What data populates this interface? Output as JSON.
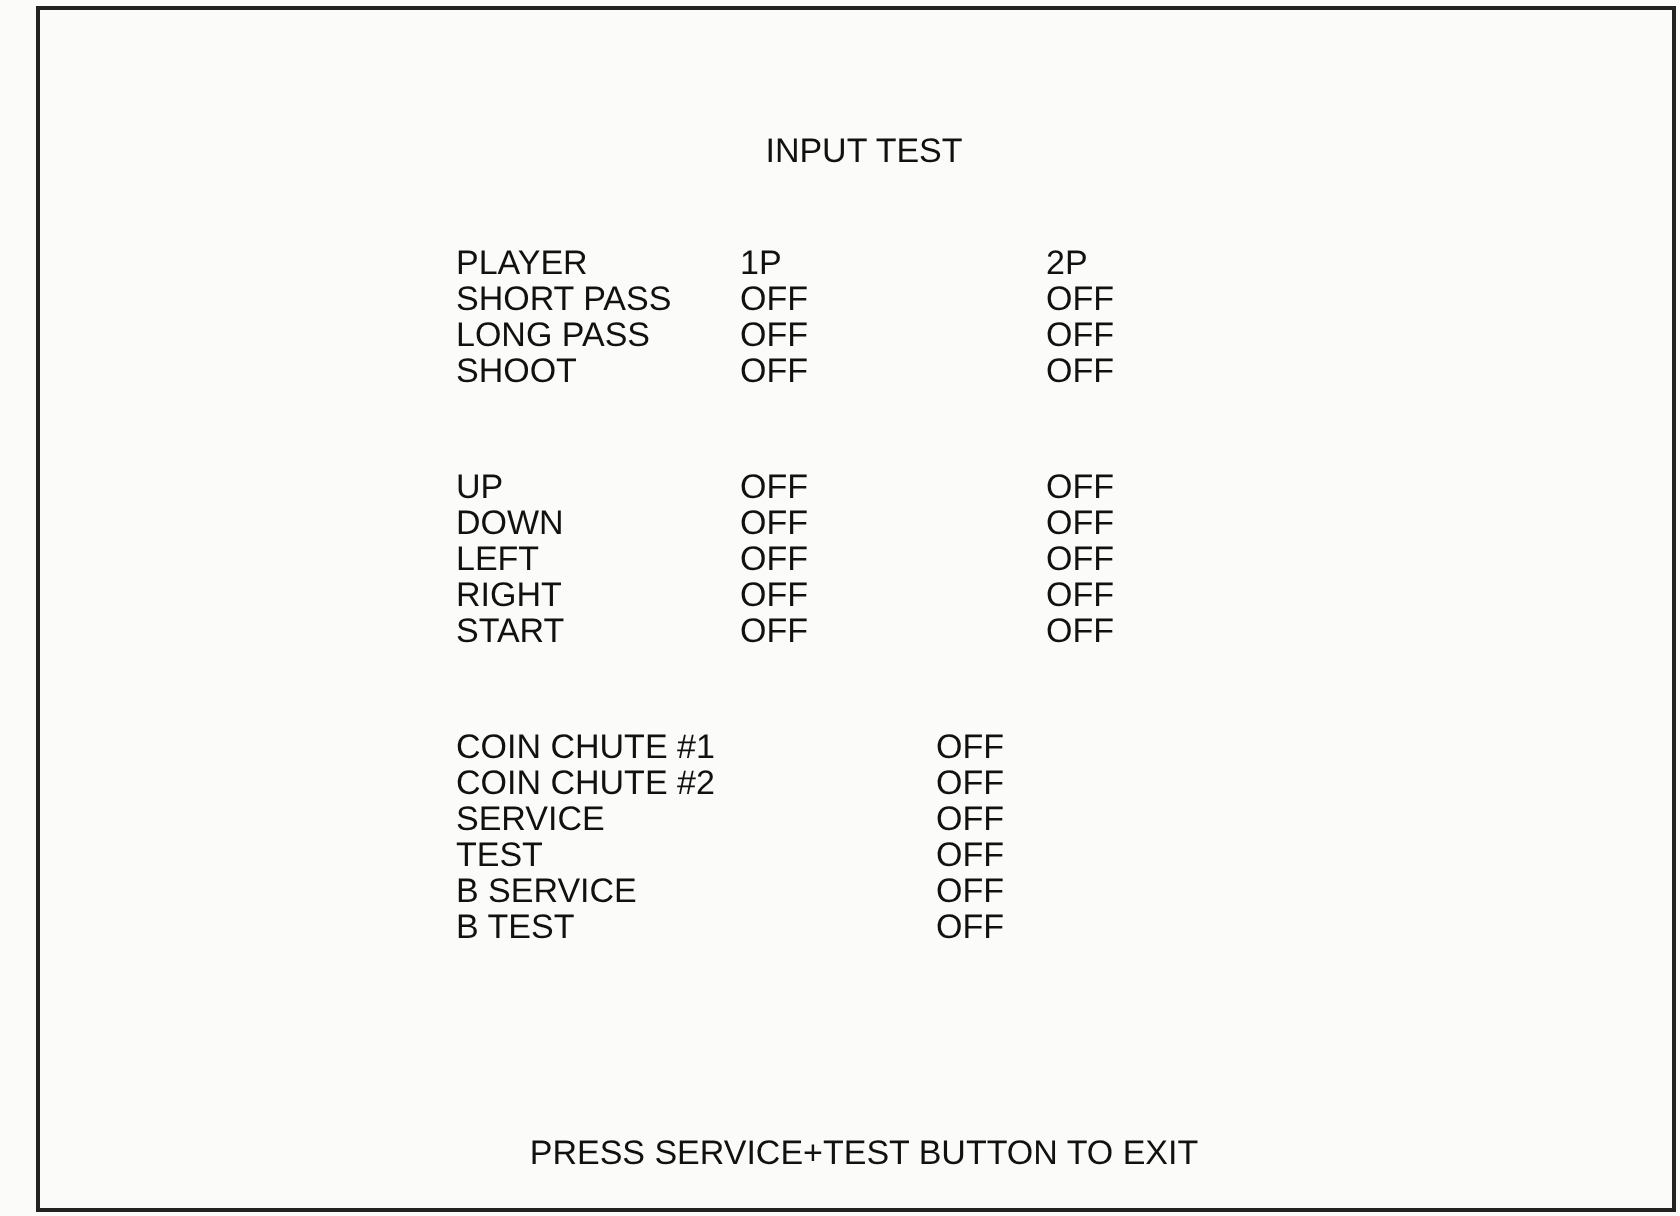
{
  "title": "INPUT TEST",
  "player_header": {
    "label": "PLAYER",
    "p1": "1P",
    "p2": "2P"
  },
  "player_groups": [
    [
      {
        "label": "SHORT PASS",
        "p1": "OFF",
        "p2": "OFF"
      },
      {
        "label": "LONG PASS",
        "p1": "OFF",
        "p2": "OFF"
      },
      {
        "label": "SHOOT",
        "p1": "OFF",
        "p2": "OFF"
      }
    ],
    [
      {
        "label": "UP",
        "p1": "OFF",
        "p2": "OFF"
      },
      {
        "label": "DOWN",
        "p1": "OFF",
        "p2": "OFF"
      },
      {
        "label": "LEFT",
        "p1": "OFF",
        "p2": "OFF"
      },
      {
        "label": "RIGHT",
        "p1": "OFF",
        "p2": "OFF"
      },
      {
        "label": "START",
        "p1": "OFF",
        "p2": "OFF"
      }
    ]
  ],
  "system_inputs": [
    {
      "label": "COIN CHUTE #1",
      "value": "OFF"
    },
    {
      "label": "COIN CHUTE #2",
      "value": "OFF"
    },
    {
      "label": "SERVICE",
      "value": "OFF"
    },
    {
      "label": "TEST",
      "value": "OFF"
    },
    {
      "label": "B SERVICE",
      "value": "OFF"
    },
    {
      "label": "B TEST",
      "value": "OFF"
    }
  ],
  "footer": "PRESS SERVICE+TEST BUTTON TO EXIT"
}
